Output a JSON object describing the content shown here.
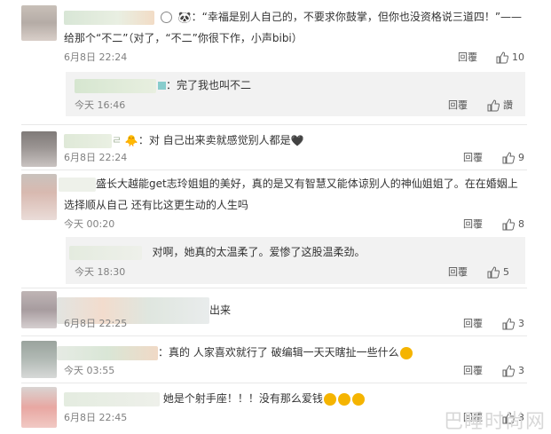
{
  "c1": {
    "line1": "：“幸福是别人自己的，不要求你鼓掌，但你也没资格说三道四！”——",
    "line2": "给那个“不二”（对了，“不二”你很下作，小声bibi）",
    "time": "6月8日 22:24",
    "reply": "回覆",
    "likes": "10"
  },
  "r1": {
    "text": "：完了我也叫不二",
    "time": "今天 16:46",
    "reply": "回覆",
    "like_label": "讚"
  },
  "c2": {
    "text": "：对 自己出来卖就感觉别人都是",
    "time": "6月8日 22:24",
    "reply": "回覆",
    "likes": "9"
  },
  "c3": {
    "line1": "盛长大越能get志玲姐姐的美好，真的是又有智慧又能体谅别人的神仙姐姐了。在在婚姻上",
    "line2": "选择顺从自己 还有比这更生动的人生吗",
    "time": "今天 00:20",
    "reply": "回覆",
    "likes": "8"
  },
  "r3": {
    "text": "对啊，她真的太温柔了。爱惨了这股温柔劲。",
    "time": "今天 18:30",
    "reply": "回覆",
    "likes": "5"
  },
  "c4": {
    "text": "出来",
    "time": "6月8日 22:25",
    "reply": "回覆",
    "likes": "3"
  },
  "c5": {
    "text": "：真的 人家喜欢就行了 破编辑一天天瞎扯一些什么",
    "time": "今天 03:55",
    "reply": "回覆",
    "likes": "3"
  },
  "c6": {
    "text": "她是个射手座！！！没有那么爱钱",
    "time": "6月8日 22:45",
    "reply": "回覆",
    "likes": "3"
  },
  "watermark": "巴睡时尚网",
  "colors": {
    "text": "#333333",
    "meta": "#808080",
    "subbg": "#f2f2f2"
  },
  "icons": [
    "thumbs-up-icon",
    "emoji-icon",
    "panda-icon",
    "heart-icon"
  ]
}
